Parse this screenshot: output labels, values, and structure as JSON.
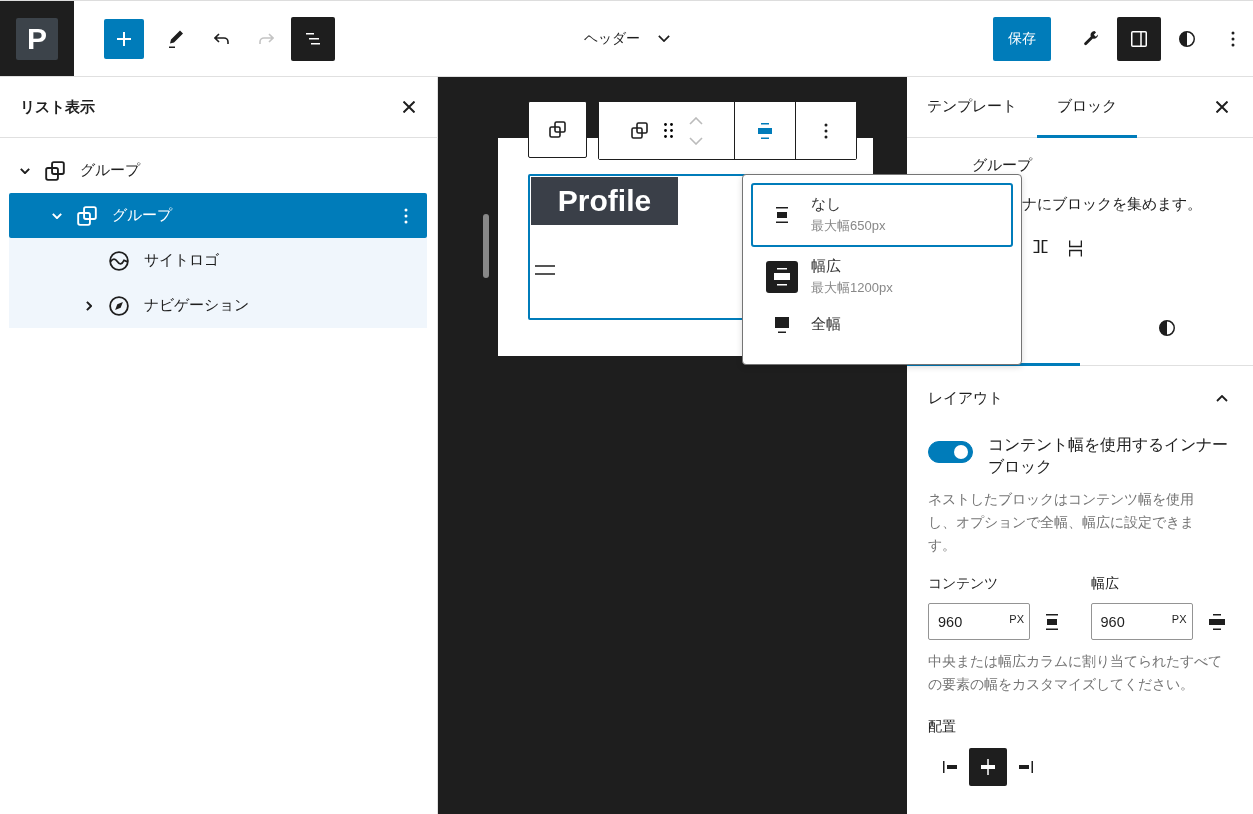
{
  "top_bar": {
    "logo": "P",
    "tools": [
      {
        "kind": "add",
        "selected": false,
        "disabled": false
      },
      {
        "kind": "edit",
        "selected": false,
        "disabled": false
      },
      {
        "kind": "undo",
        "selected": false,
        "disabled": false
      },
      {
        "kind": "redo",
        "selected": false,
        "disabled": true
      },
      {
        "kind": "list",
        "selected": true,
        "disabled": false
      }
    ],
    "document_title": "ヘッダー",
    "save_label": "保存",
    "actions": [
      {
        "kind": "settings",
        "selected": false
      },
      {
        "kind": "sidebar",
        "selected": true
      },
      {
        "kind": "styles",
        "selected": false
      },
      {
        "kind": "more",
        "selected": false
      }
    ]
  },
  "list_view": {
    "title": "リスト表示",
    "items": [
      {
        "label": "グループ",
        "kind": "group",
        "expanded": true,
        "selected": false,
        "children": [
          {
            "label": "グループ",
            "kind": "group",
            "expanded": true,
            "selected": true,
            "children": [
              {
                "label": "サイトロゴ",
                "kind": "site-logo",
                "selected": false
              },
              {
                "label": "ナビゲーション",
                "kind": "navigation",
                "expanded": false,
                "selected": false
              }
            ]
          }
        ]
      }
    ]
  },
  "canvas": {
    "logo_text": "Profile",
    "block_selected": true
  },
  "width_menu": {
    "options": [
      {
        "kind": "none",
        "label": "なし",
        "detail": "最大幅650px",
        "selected": true
      },
      {
        "kind": "wide",
        "label": "幅広",
        "detail": "最大幅1200px",
        "selected": false
      },
      {
        "kind": "full",
        "label": "全幅",
        "selected": false
      }
    ]
  },
  "sidebar": {
    "tabs": [
      {
        "label": "テンプレート",
        "selected": false
      },
      {
        "label": "ブロック",
        "selected": true
      }
    ],
    "block_card": {
      "title": "グループ",
      "description": "ナにブロックを集めます。"
    },
    "inspector_tabs": [
      {
        "kind": "settings",
        "selected": true
      },
      {
        "kind": "styles",
        "selected": false
      }
    ],
    "layout": {
      "title": "レイアウト",
      "expanded": true,
      "toggle": {
        "label": "コンテント幅を使用するインナーブロック",
        "on": true
      },
      "help": "ネストしたブロックはコンテンツ幅を使用し、オプションで全幅、幅広に設定できます。",
      "fields": [
        {
          "kind": "content",
          "label": "コンテンツ",
          "value": "960",
          "unit": "PX"
        },
        {
          "kind": "wide",
          "label": "幅広",
          "value": "960",
          "unit": "PX"
        }
      ],
      "help_2": "中央または幅広カラムに割り当てられたすべての要素の幅をカスタマイズしてください。",
      "justification": {
        "label": "配置",
        "options": [
          {
            "kind": "left",
            "selected": false
          },
          {
            "kind": "center",
            "selected": true
          },
          {
            "kind": "right",
            "selected": false
          }
        ]
      }
    }
  }
}
